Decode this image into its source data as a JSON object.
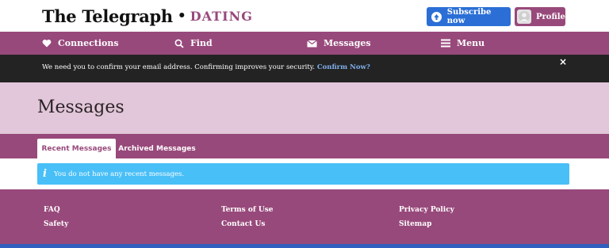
{
  "header": {
    "logo_main": "The Telegraph",
    "logo_separator": "•",
    "logo_sub": "DATING",
    "subscribe_label": "Subscribe now",
    "profile_label": "Profile"
  },
  "nav": {
    "items": [
      {
        "label": "Connections",
        "icon": "heart-icon"
      },
      {
        "label": "Find",
        "icon": "search-icon"
      },
      {
        "label": "Messages",
        "icon": "envelope-icon"
      },
      {
        "label": "Menu",
        "icon": "hamburger-icon"
      }
    ]
  },
  "alert": {
    "text": "We need you to confirm your email address. Confirming improves your security.",
    "link": "Confirm Now?",
    "close": "×"
  },
  "page": {
    "title": "Messages"
  },
  "tabs": [
    {
      "label": "Recent Messages",
      "active": true
    },
    {
      "label": "Archived Messages",
      "active": false
    }
  ],
  "content": {
    "info_icon": "i",
    "info_text": "You do not have any recent messages."
  },
  "footer": {
    "links": [
      "FAQ",
      "Safety",
      "Terms of Use",
      "Contact Us",
      "Privacy Policy",
      "Sitemap"
    ]
  },
  "colors": {
    "brand_purple": "#98497b",
    "title_band": "#e2c6d9",
    "alert_bg": "#232324",
    "info_blue": "#49bff7",
    "subscribe_blue": "#2b6fd6"
  }
}
